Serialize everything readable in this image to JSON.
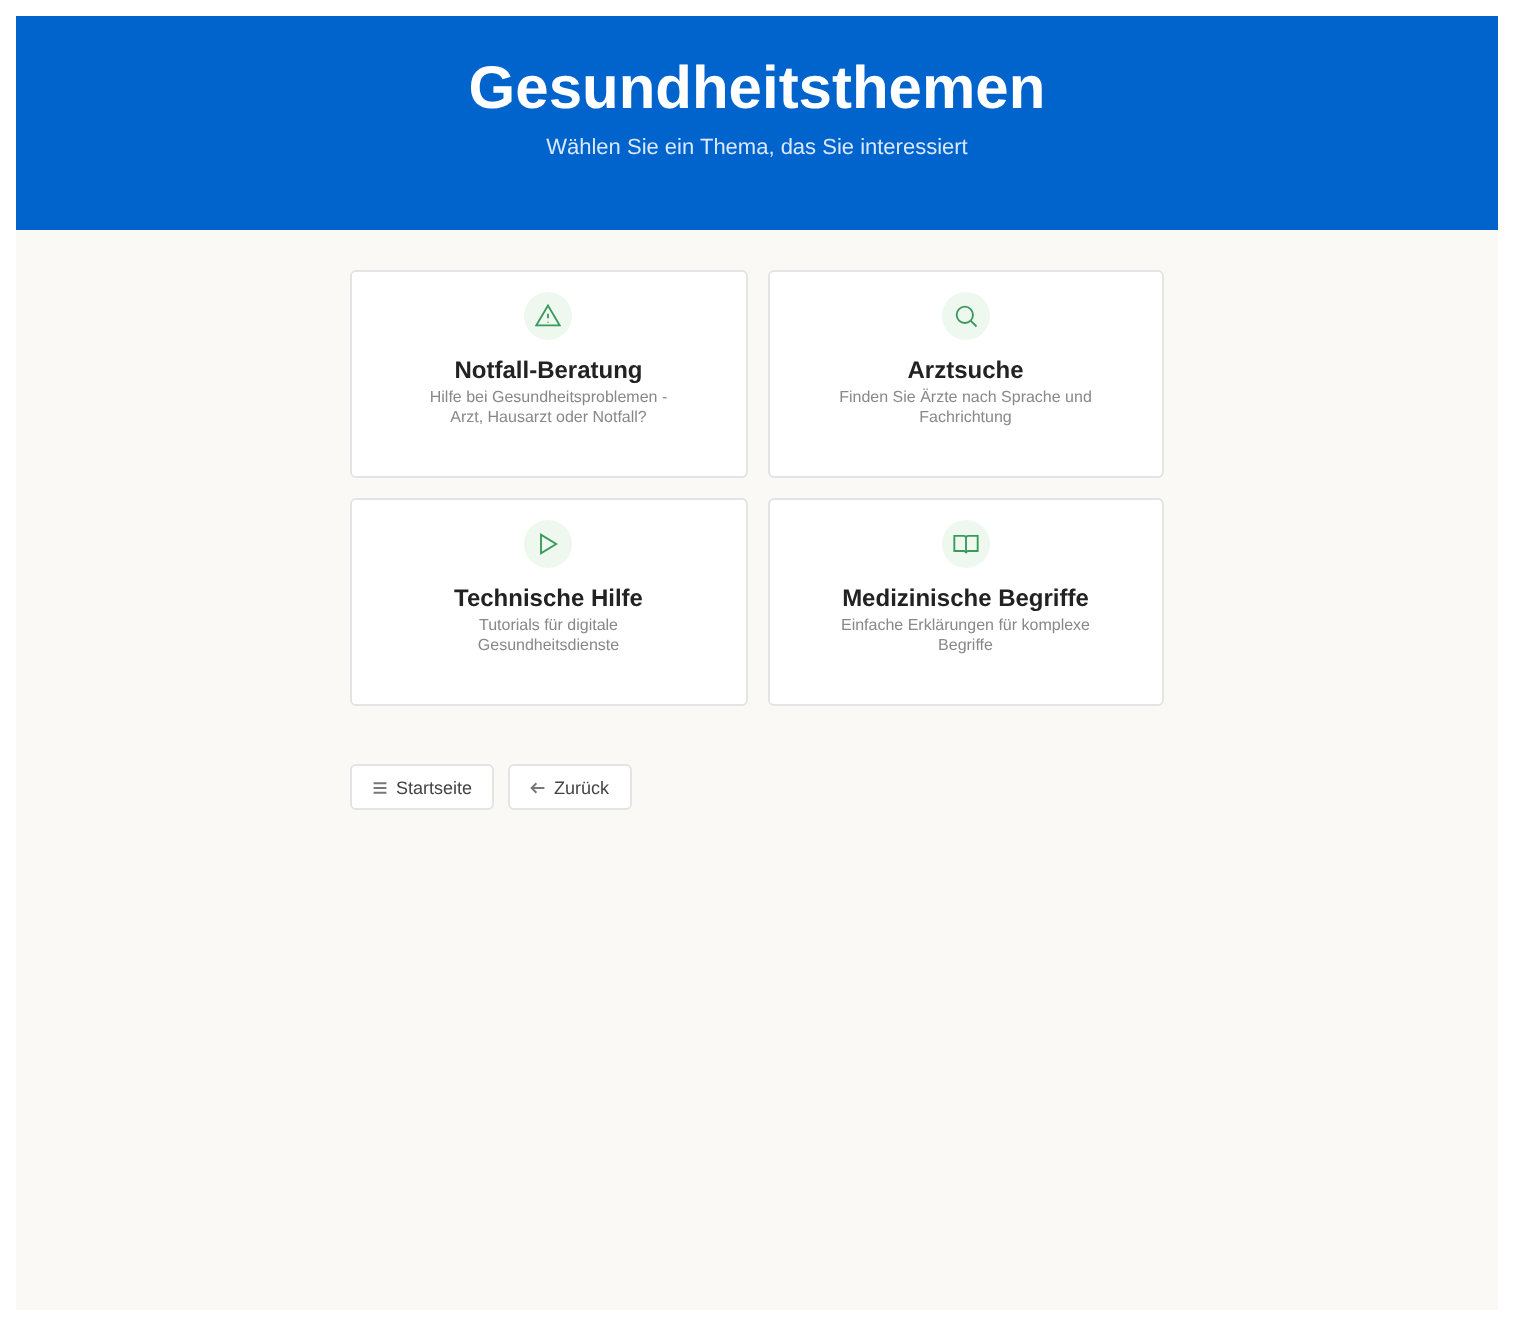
{
  "header": {
    "title": "Gesundheitsthemen",
    "subtitle": "Wählen Sie ein Thema, das Sie interessiert"
  },
  "topics": [
    {
      "title": "Notfall-Beratung",
      "description": "Hilfe bei Gesundheitsproblemen - Arzt, Hausarzt oder Notfall?"
    },
    {
      "title": "Arztsuche",
      "description": "Finden Sie Ärzte nach Sprache und Fachrichtung"
    },
    {
      "title": "Technische Hilfe",
      "description": "Tutorials für digitale Gesundheitsdienste"
    },
    {
      "title": "Medizinische Begriffe",
      "description": "Einfache Erklärungen für komplexe Begriffe"
    }
  ],
  "buttons": [
    {
      "label": "Startseite"
    },
    {
      "label": "Zurück"
    }
  ]
}
